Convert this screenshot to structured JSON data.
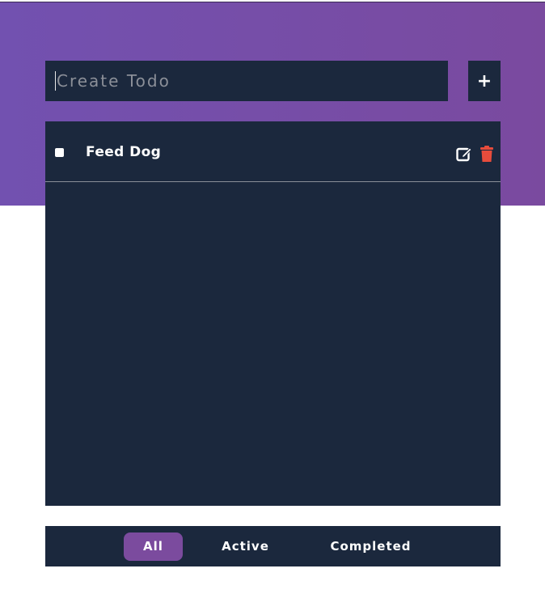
{
  "input": {
    "value": "",
    "placeholder": "Create Todo"
  },
  "add_button": {
    "label": "+"
  },
  "todos": [
    {
      "text": "Feed Dog",
      "completed": false
    }
  ],
  "filters": {
    "all": "All",
    "active": "Active",
    "completed": "Completed",
    "selected": "All"
  },
  "colors": {
    "accent": "#7b4b9e",
    "panel": "#1b283d",
    "delete": "#e74c3c"
  },
  "icons": {
    "edit": "edit-icon",
    "delete": "trash-icon"
  }
}
